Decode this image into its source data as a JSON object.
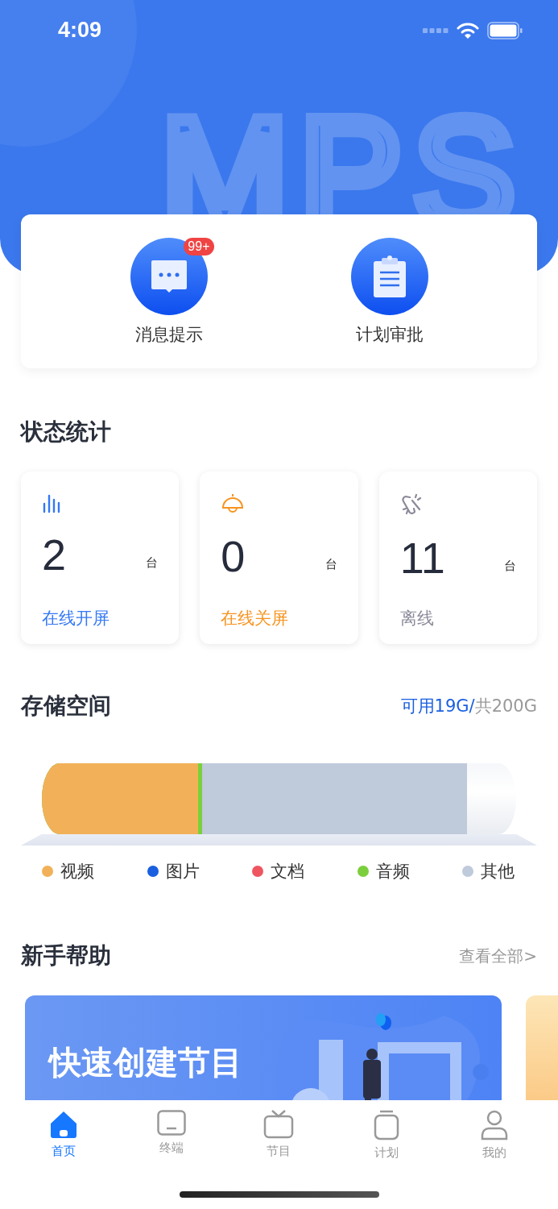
{
  "status_bar": {
    "time": "4:09"
  },
  "header": {
    "watermark_text": "MPS"
  },
  "quick_actions": [
    {
      "kind": "message",
      "label": "消息提示",
      "badge": "99+"
    },
    {
      "kind": "approval",
      "label": "计划审批"
    }
  ],
  "status_stats": {
    "title": "状态统计",
    "cards": [
      {
        "kind": "bars",
        "value": "2",
        "unit": "台",
        "label": "在线开屏",
        "color": "#3478f6"
      },
      {
        "kind": "lamp",
        "value": "0",
        "unit": "台",
        "label": "在线关屏",
        "color": "#f7931e"
      },
      {
        "kind": "unlink",
        "value": "11",
        "unit": "台",
        "label": "离线",
        "color": "#8a8a9a"
      }
    ]
  },
  "storage": {
    "title": "存储空间",
    "available": "可用19G/",
    "total": "共200G",
    "categories": [
      {
        "label": "视频",
        "color": "#f2b158"
      },
      {
        "label": "图片",
        "color": "#1a5fe0"
      },
      {
        "label": "文档",
        "color": "#ef5560"
      },
      {
        "label": "音频",
        "color": "#7ccf3c"
      },
      {
        "label": "其他",
        "color": "#bfcadb"
      }
    ],
    "bar_segments": [
      {
        "color": "#f2b158",
        "level": 0.33
      },
      {
        "color": "#7ccf3c",
        "level": 0.338
      },
      {
        "color": "#bfcadb",
        "level": 0.896
      }
    ]
  },
  "help": {
    "title": "新手帮助",
    "view_all": "查看全部>",
    "banners": [
      {
        "title": "快速创建节目"
      }
    ]
  },
  "tab_bar": [
    {
      "kind": "home",
      "label": "首页",
      "selected": true
    },
    {
      "kind": "terminal",
      "label": "终端",
      "selected": false
    },
    {
      "kind": "tv",
      "label": "节目",
      "selected": false
    },
    {
      "kind": "plan",
      "label": "计划",
      "selected": false
    },
    {
      "kind": "user",
      "label": "我的",
      "selected": false
    }
  ]
}
